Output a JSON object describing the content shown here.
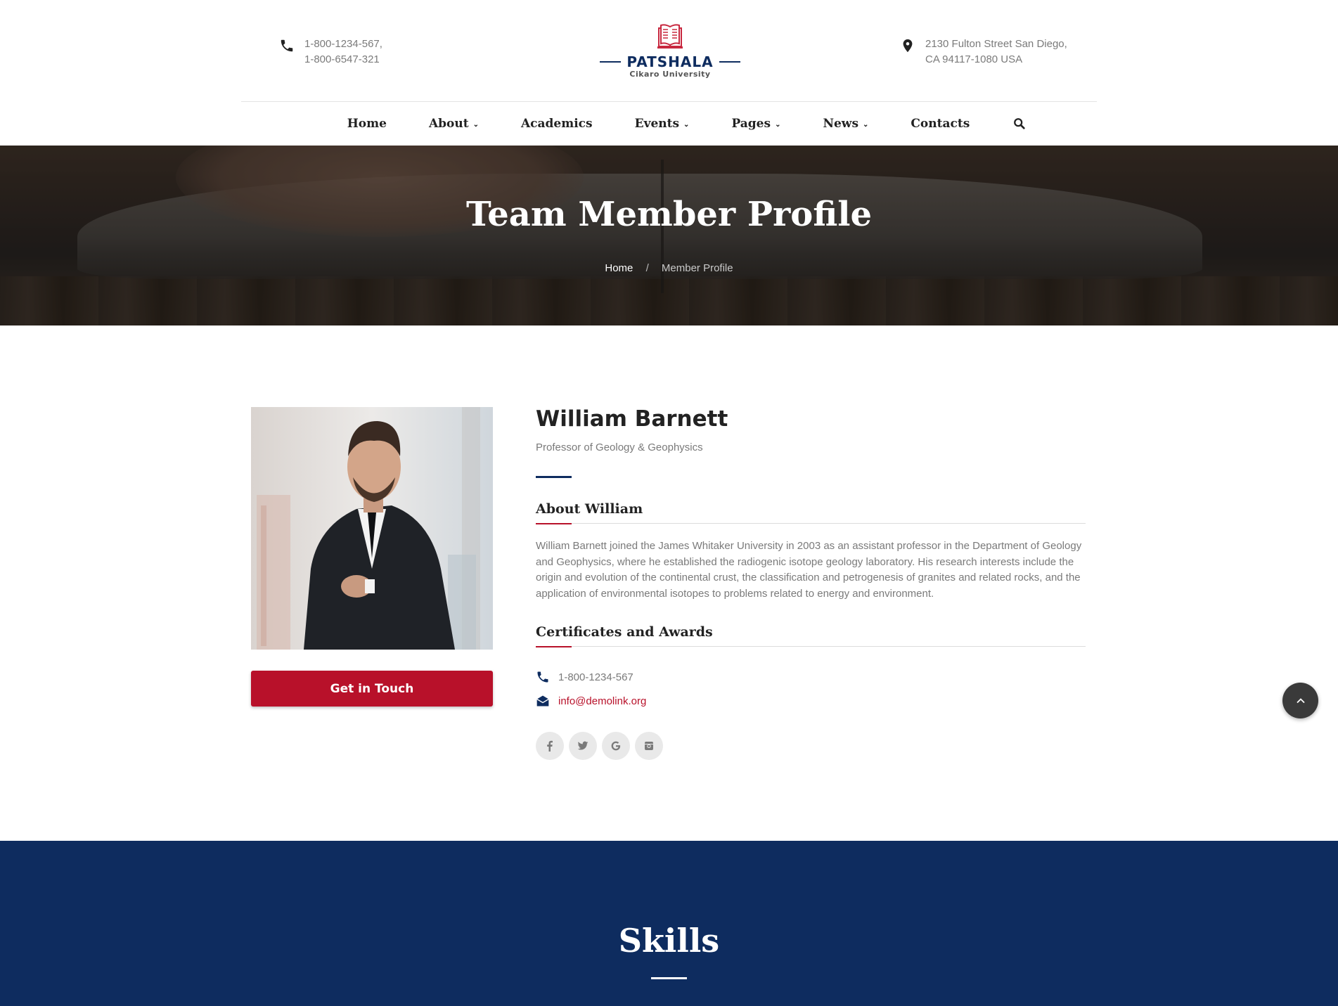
{
  "header": {
    "phone_line1": "1-800-1234-567,",
    "phone_line2": "1-800-6547-321",
    "address_line1": "2130 Fulton Street San Diego,",
    "address_line2": "CA 94117-1080 USA",
    "logo_title": "PATSHALA",
    "logo_subtitle": "Cikaro University"
  },
  "nav": {
    "items": [
      {
        "label": "Home",
        "dropdown": false
      },
      {
        "label": "About",
        "dropdown": true
      },
      {
        "label": "Academics",
        "dropdown": false
      },
      {
        "label": "Events",
        "dropdown": true
      },
      {
        "label": "Pages",
        "dropdown": true
      },
      {
        "label": "News",
        "dropdown": true
      },
      {
        "label": "Contacts",
        "dropdown": false
      }
    ],
    "search_icon": "search-icon"
  },
  "hero": {
    "title": "Team Member Profile",
    "breadcrumb_home": "Home",
    "breadcrumb_sep": "/",
    "breadcrumb_current": "Member Profile"
  },
  "profile": {
    "name": "William Barnett",
    "position": "Professor of Geology & Geophysics",
    "button_label": "Get in Touch",
    "about_heading": "About William",
    "about_text": "William Barnett joined the James Whitaker University in 2003 as an assistant professor in the Department of Geology and Geophysics, where he established the radiogenic isotope geology laboratory. His research interests include the origin and evolution of the continental crust, the classification and petrogenesis of granites and related rocks, and the application of environmental isotopes to problems related to energy and environment.",
    "certificates_heading": "Certificates and Awards",
    "phone": "1-800-1234-567",
    "email": "info@demolink.org",
    "socials": [
      {
        "icon": "facebook-icon",
        "glyph": "f"
      },
      {
        "icon": "twitter-icon",
        "glyph": "t"
      },
      {
        "icon": "google-icon",
        "glyph": "G"
      },
      {
        "icon": "instagram-icon",
        "glyph": "ig"
      }
    ]
  },
  "skills": {
    "title": "Skills"
  },
  "colors": {
    "brand_navy": "#0e2c5f",
    "brand_red": "#b8112a"
  }
}
